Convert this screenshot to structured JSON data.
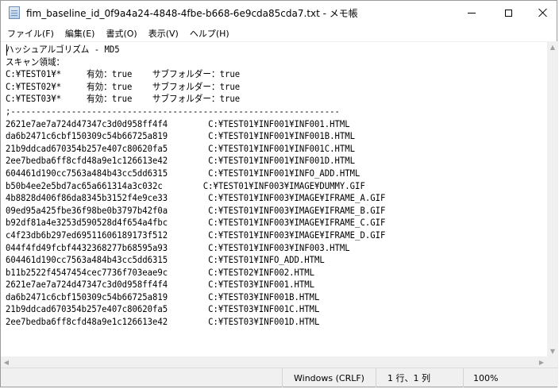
{
  "window": {
    "title": "fim_baseline_id_0f9a4a24-4848-4fbe-b668-6e9cda85cda7.txt - メモ帳"
  },
  "menu": [
    "ファイル(F)",
    "編集(E)",
    "書式(O)",
    "表示(V)",
    "ヘルプ(H)"
  ],
  "editor": {
    "lines": [
      "ハッシュアルゴリズム - MD5",
      "スキャン領域：",
      "C:¥TEST01¥*     有効：true    サブフォルダー：true",
      "C:¥TEST02¥*     有効：true    サブフォルダー：true",
      "C:¥TEST03¥*     有効：true    サブフォルダー：true",
      ";-----------------------------------------------------------------",
      "2621e7ae7a724d47347c3d0d958ff4f4        C:¥TEST01¥INF001¥INF001.HTML",
      "da6b2471c6cbf150309c54b66725a819        C:¥TEST01¥INF001¥INF001B.HTML",
      "21b9ddcad670354b257e407c80620fa5        C:¥TEST01¥INF001¥INF001C.HTML",
      "2ee7bedba6ff8cfd48a9e1c126613e42        C:¥TEST01¥INF001¥INF001D.HTML",
      "604461d190cc7563a484b43cc5dd6315        C:¥TEST01¥INF001¥INFO_ADD.HTML",
      "b50b4ee2e5bd7ac65a661314a3c032c        C:¥TEST01¥INF003¥IMAGE¥DUMMY.GIF",
      "4b8828d406f86da8345b3152f4e9ce33        C:¥TEST01¥INF003¥IMAGE¥IFRAME_A.GIF",
      "09ed95a425fbe36f98be0b3797b42f0a        C:¥TEST01¥INF003¥IMAGE¥IFRAME_B.GIF",
      "b92df81a4e3253d590528d4f654a4fbc        C:¥TEST01¥INF003¥IMAGE¥IFRAME_C.GIF",
      "c4f23db6b297ed69511606189173f512        C:¥TEST01¥INF003¥IMAGE¥IFRAME_D.GIF",
      "044f4fd49fcbf4432368277b68595a93        C:¥TEST01¥INF003¥INF003.HTML",
      "604461d190cc7563a484b43cc5dd6315        C:¥TEST01¥INFO_ADD.HTML",
      "b11b2522f4547454cec7736f703eae9c        C:¥TEST02¥INF002.HTML",
      "2621e7ae7a724d47347c3d0d958ff4f4        C:¥TEST03¥INF001.HTML",
      "da6b2471c6cbf150309c54b66725a819        C:¥TEST03¥INF001B.HTML",
      "21b9ddcad670354b257e407c80620fa5        C:¥TEST03¥INF001C.HTML",
      "2ee7bedba6ff8cfd48a9e1c126613e42        C:¥TEST03¥INF001D.HTML"
    ]
  },
  "statusbar": {
    "line_ending": "Windows (CRLF)",
    "position": "1 行、1 列",
    "zoom": "100%"
  }
}
